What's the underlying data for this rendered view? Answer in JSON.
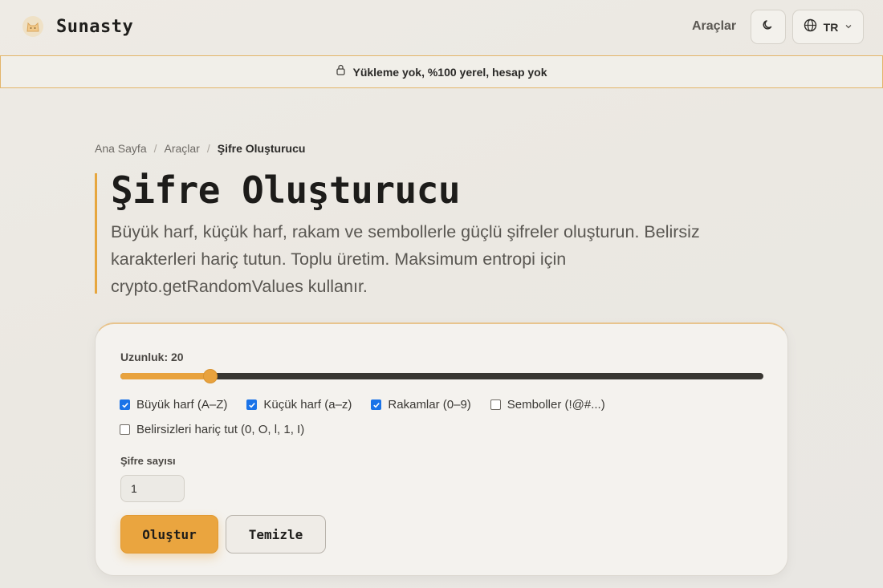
{
  "header": {
    "brand": "Sunasty",
    "nav_tools": "Araçlar",
    "theme_icon": "moon-icon",
    "lang_icon": "globe-icon",
    "lang": "TR"
  },
  "privacy_banner": {
    "icon": "lock-icon",
    "text": "Yükleme yok, %100 yerel, hesap yok"
  },
  "breadcrumb": {
    "items": [
      "Ana Sayfa",
      "Araçlar",
      "Şifre Oluşturucu"
    ],
    "separator": "/"
  },
  "hero": {
    "title": "Şifre Oluşturucu",
    "description": "Büyük harf, küçük harf, rakam ve sembollerle güçlü şifreler oluşturun. Belirsiz karakterleri hariç tutun. Toplu üretim. Maksimum entropi için crypto.getRandomValues kullanır."
  },
  "form": {
    "length_label": "Uzunluk: 20",
    "length_value": 20,
    "length_fraction": 0.14,
    "options": [
      {
        "label": "Büyük harf (A–Z)",
        "checked": true
      },
      {
        "label": "Küçük harf (a–z)",
        "checked": true
      },
      {
        "label": "Rakamlar (0–9)",
        "checked": true
      },
      {
        "label": "Semboller (!@#...)",
        "checked": false
      },
      {
        "label": "Belirsizleri hariç tut (0, O, l, 1, I)",
        "checked": false
      }
    ],
    "count_label": "Şifre sayısı",
    "count_value": "1",
    "generate_label": "Oluştur",
    "clear_label": "Temizle"
  },
  "colors": {
    "accent": "#e8a23d",
    "checkbox": "#1a73e8"
  }
}
